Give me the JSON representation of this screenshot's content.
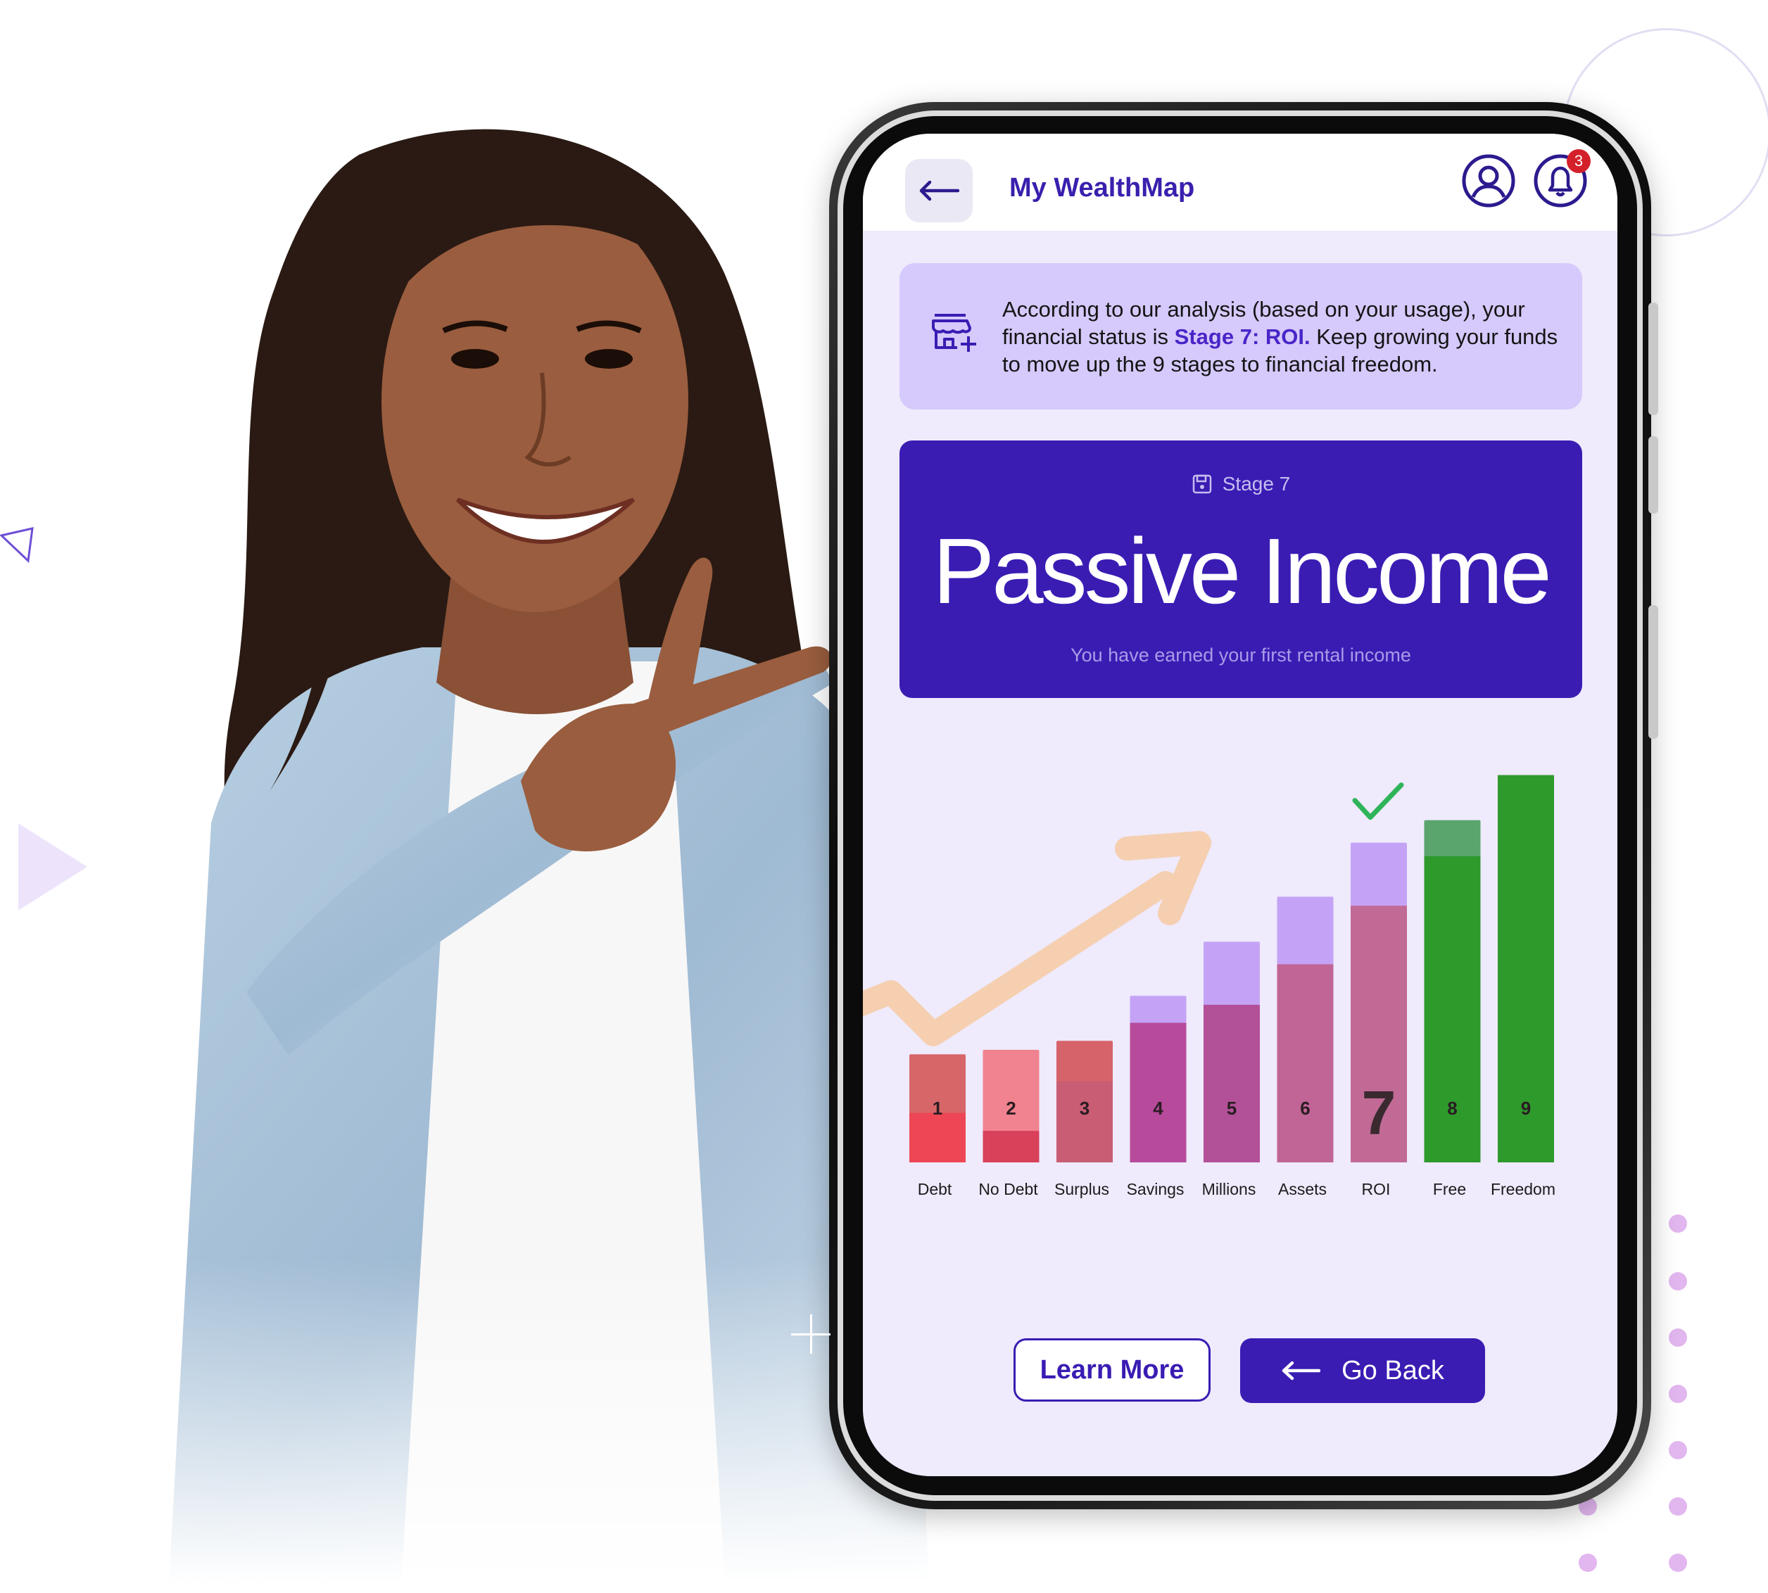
{
  "header": {
    "title": "My WealthMap",
    "back_icon": "arrow-left-icon",
    "profile_icon": "user-circle-icon",
    "notifications_icon": "bell-icon",
    "notification_count": "3"
  },
  "banner": {
    "icon": "store-add-icon",
    "text_before": "According to our analysis (based on your usage), your financial status is ",
    "highlight": "Stage 7: ROI.",
    "text_after": " Keep growing your funds to move up the 9 stages to financial freedom."
  },
  "stage_card": {
    "icon": "save-icon",
    "label": "Stage 7",
    "title": "Passive Income",
    "subtitle": "You have earned your first rental income"
  },
  "chart_data": {
    "type": "bar",
    "current_stage": 7,
    "categories": [
      "Debt",
      "No Debt",
      "Surplus",
      "Savings",
      "Millions",
      "Assets",
      "ROI",
      "Free",
      "Freedom"
    ],
    "stage_numbers": [
      "1",
      "2",
      "3",
      "4",
      "5",
      "6",
      "7",
      "8",
      "9"
    ],
    "values": [
      24,
      25,
      27,
      37,
      49,
      59,
      71,
      76,
      86
    ],
    "fill_values": [
      11,
      7,
      18,
      31,
      35,
      44,
      57,
      68,
      86
    ],
    "ylim": [
      0,
      100
    ],
    "colors": {
      "bar_tops": [
        "#d76669",
        "#f0838f",
        "#d6636a",
        "#c4a3f6",
        "#c4a3f6",
        "#c4a3f6",
        "#c4a3f6",
        "#5aa56e",
        "#2e9a2c"
      ],
      "bar_fills": [
        "#ee4655",
        "#d9405a",
        "#c85d74",
        "#b74a9b",
        "#b25198",
        "#c06595",
        "#c16a96",
        "#2e9a2c",
        "#2e9a2c"
      ],
      "check": "#2fb45a",
      "trend_arrow": "#f5cfb0"
    }
  },
  "buttons": {
    "learn_more": "Learn More",
    "go_back": "Go Back",
    "go_back_icon": "arrow-left-icon"
  },
  "decorations": {
    "dot_color": "#e2b6ef",
    "plus_color": "#f4a48b"
  }
}
